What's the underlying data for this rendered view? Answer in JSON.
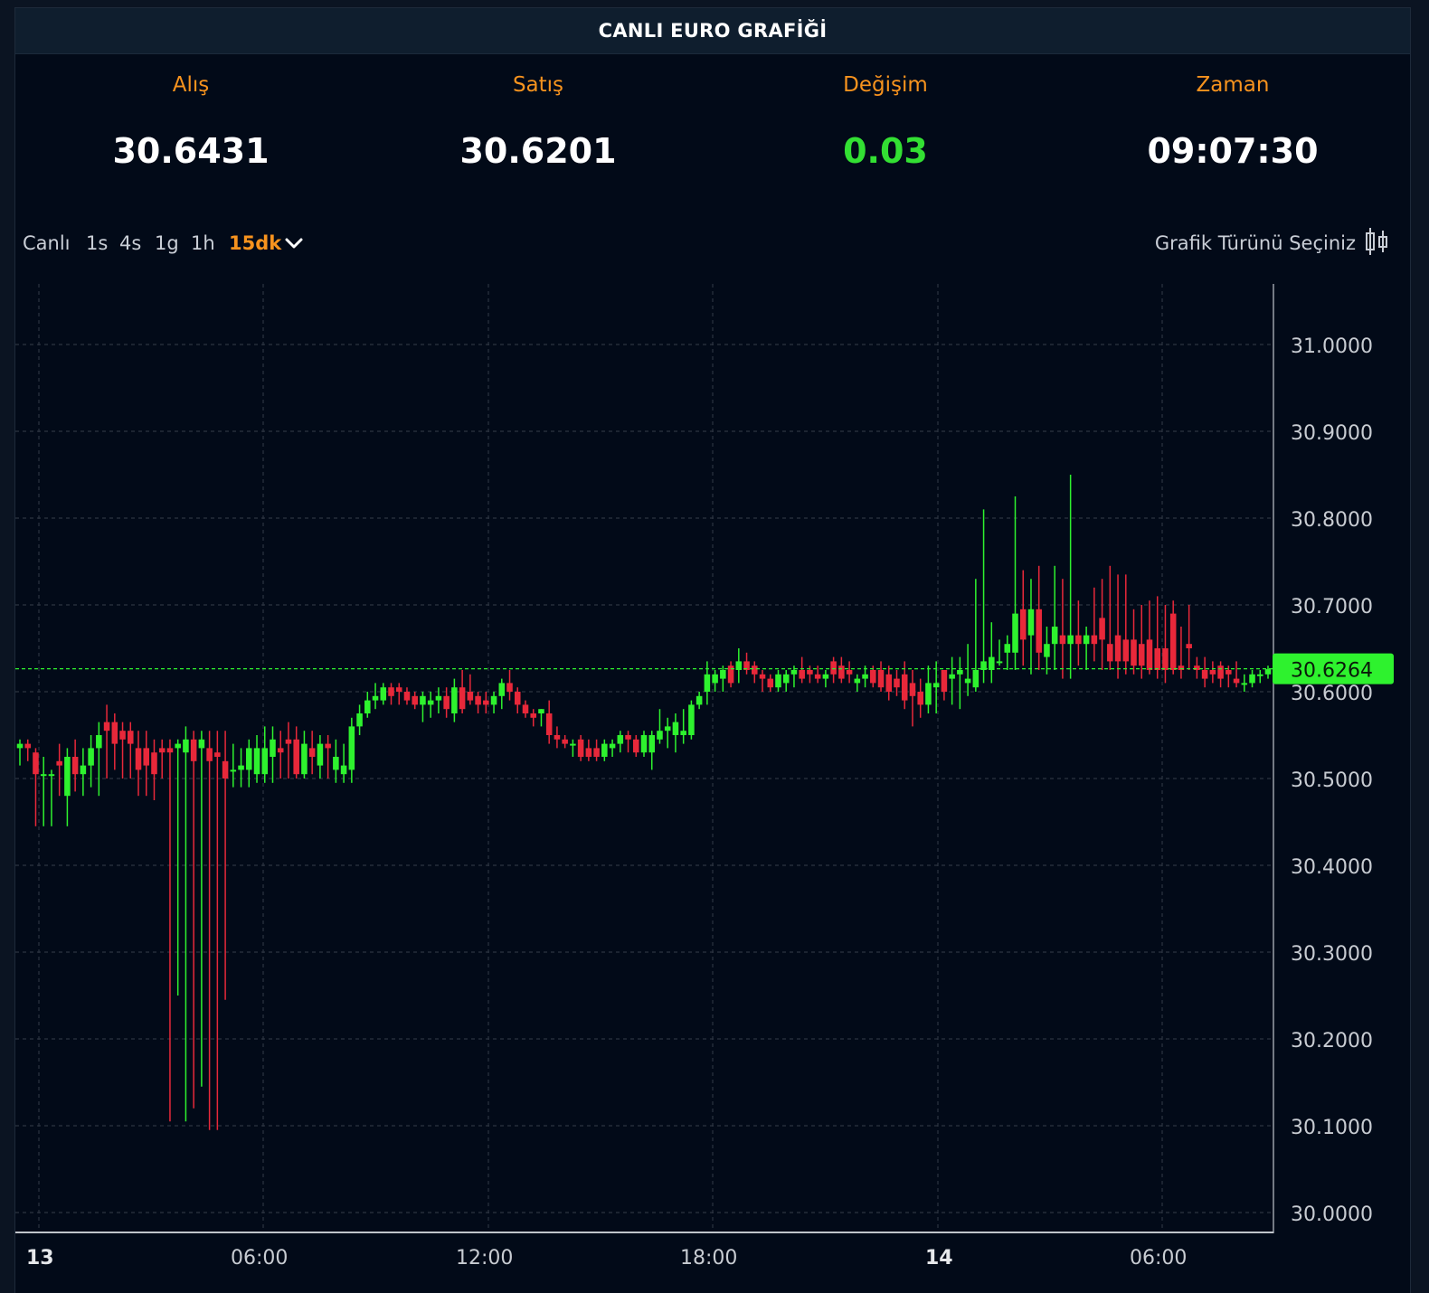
{
  "header": {
    "title": "CANLI EURO GRAFİĞİ"
  },
  "stats": [
    {
      "label": "Alış",
      "value": "30.6431"
    },
    {
      "label": "Satış",
      "value": "30.6201"
    },
    {
      "label": "Değişim",
      "value": "0.03"
    },
    {
      "label": "Zaman",
      "value": "09:07:30"
    }
  ],
  "colors": {
    "accent": "#f7931e",
    "up": "#2ef22e",
    "down": "#e8283a",
    "change_positive": "#33e033",
    "current_price_bg": "#2ef22e"
  },
  "toolbar": {
    "timeframes": [
      "Canlı",
      "1s",
      "4s",
      "1g",
      "1h",
      "15dk"
    ],
    "active_timeframe": "15dk",
    "dropdown_icon": "chevron-down-icon",
    "chart_type_label": "Grafik Türünü Seçiniz",
    "chart_type_icon": "candlestick-icon"
  },
  "chart_data": {
    "type": "candlestick",
    "x_tick_labels": [
      "13",
      "06:00",
      "12:00",
      "18:00",
      "14",
      "06:00"
    ],
    "y_tick_labels": [
      "31.0000",
      "30.9000",
      "30.8000",
      "30.7000",
      "30.6000",
      "30.5000",
      "30.4000",
      "30.3000",
      "30.2000",
      "30.1000",
      "30.0000"
    ],
    "ylim": [
      29.98,
      31.07
    ],
    "current_price": "30.6264",
    "current_price_value": 30.6264,
    "grid": true,
    "interval": "15dk",
    "candles": [
      [
        30.535,
        30.545,
        30.515,
        30.54
      ],
      [
        30.54,
        30.545,
        30.52,
        30.535
      ],
      [
        30.53,
        30.535,
        30.445,
        30.505
      ],
      [
        30.505,
        30.525,
        30.445,
        30.505
      ],
      [
        30.505,
        30.51,
        30.445,
        30.505
      ],
      [
        30.52,
        30.54,
        30.48,
        30.515
      ],
      [
        30.48,
        30.535,
        30.445,
        30.525
      ],
      [
        30.525,
        30.545,
        30.485,
        30.505
      ],
      [
        30.505,
        30.535,
        30.48,
        30.515
      ],
      [
        30.515,
        30.55,
        30.49,
        30.535
      ],
      [
        30.535,
        30.565,
        30.48,
        30.55
      ],
      [
        30.565,
        30.585,
        30.5,
        30.555
      ],
      [
        30.565,
        30.575,
        30.51,
        30.54
      ],
      [
        30.555,
        30.565,
        30.5,
        30.545
      ],
      [
        30.555,
        30.565,
        30.5,
        30.54
      ],
      [
        30.535,
        30.555,
        30.48,
        30.51
      ],
      [
        30.535,
        30.555,
        30.48,
        30.515
      ],
      [
        30.53,
        30.545,
        30.475,
        30.505
      ],
      [
        30.535,
        30.545,
        30.5,
        30.53
      ],
      [
        30.535,
        30.545,
        30.105,
        30.53
      ],
      [
        30.535,
        30.545,
        30.25,
        30.54
      ],
      [
        30.53,
        30.56,
        30.105,
        30.545
      ],
      [
        30.545,
        30.555,
        30.12,
        30.52
      ],
      [
        30.535,
        30.555,
        30.145,
        30.545
      ],
      [
        30.535,
        30.555,
        30.095,
        30.52
      ],
      [
        30.53,
        30.555,
        30.095,
        30.525
      ],
      [
        30.52,
        30.555,
        30.245,
        30.5
      ],
      [
        30.51,
        30.54,
        30.49,
        30.51
      ],
      [
        30.51,
        30.535,
        30.49,
        30.515
      ],
      [
        30.51,
        30.545,
        30.49,
        30.535
      ],
      [
        30.505,
        30.55,
        30.495,
        30.535
      ],
      [
        30.505,
        30.56,
        30.495,
        30.535
      ],
      [
        30.525,
        30.56,
        30.495,
        30.545
      ],
      [
        30.535,
        30.555,
        30.5,
        30.53
      ],
      [
        30.545,
        30.565,
        30.5,
        30.54
      ],
      [
        30.545,
        30.56,
        30.5,
        30.505
      ],
      [
        30.505,
        30.555,
        30.5,
        30.54
      ],
      [
        30.535,
        30.555,
        30.505,
        30.525
      ],
      [
        30.515,
        30.55,
        30.5,
        30.54
      ],
      [
        30.54,
        30.55,
        30.5,
        30.535
      ],
      [
        30.51,
        30.545,
        30.495,
        30.525
      ],
      [
        30.505,
        30.54,
        30.495,
        30.515
      ],
      [
        30.51,
        30.57,
        30.495,
        30.56
      ],
      [
        30.56,
        30.585,
        30.55,
        30.575
      ],
      [
        30.575,
        30.6,
        30.57,
        30.59
      ],
      [
        30.59,
        30.61,
        30.58,
        30.595
      ],
      [
        30.59,
        30.61,
        30.585,
        30.605
      ],
      [
        30.605,
        30.61,
        30.585,
        30.595
      ],
      [
        30.605,
        30.61,
        30.585,
        30.6
      ],
      [
        30.6,
        30.605,
        30.585,
        30.59
      ],
      [
        30.595,
        30.6,
        30.58,
        30.585
      ],
      [
        30.585,
        30.6,
        30.565,
        30.595
      ],
      [
        30.585,
        30.6,
        30.57,
        30.59
      ],
      [
        30.59,
        30.605,
        30.575,
        30.595
      ],
      [
        30.595,
        30.605,
        30.57,
        30.58
      ],
      [
        30.575,
        30.615,
        30.565,
        30.605
      ],
      [
        30.605,
        30.625,
        30.575,
        30.58
      ],
      [
        30.6,
        30.62,
        30.585,
        30.59
      ],
      [
        30.595,
        30.6,
        30.575,
        30.585
      ],
      [
        30.59,
        30.6,
        30.575,
        30.585
      ],
      [
        30.585,
        30.6,
        30.575,
        30.595
      ],
      [
        30.595,
        30.615,
        30.58,
        30.61
      ],
      [
        30.61,
        30.625,
        30.59,
        30.6
      ],
      [
        30.6,
        30.605,
        30.575,
        30.585
      ],
      [
        30.585,
        30.59,
        30.57,
        30.575
      ],
      [
        30.575,
        30.58,
        30.56,
        30.57
      ],
      [
        30.575,
        30.58,
        30.56,
        30.58
      ],
      [
        30.575,
        30.59,
        30.54,
        30.55
      ],
      [
        30.55,
        30.56,
        30.535,
        30.545
      ],
      [
        30.545,
        30.55,
        30.535,
        30.54
      ],
      [
        30.54,
        30.545,
        30.525,
        30.54
      ],
      [
        30.545,
        30.55,
        30.52,
        30.525
      ],
      [
        30.535,
        30.545,
        30.52,
        30.525
      ],
      [
        30.535,
        30.545,
        30.52,
        30.525
      ],
      [
        30.525,
        30.545,
        30.52,
        30.54
      ],
      [
        30.535,
        30.545,
        30.525,
        30.54
      ],
      [
        30.54,
        30.555,
        30.53,
        30.55
      ],
      [
        30.55,
        30.555,
        30.53,
        30.545
      ],
      [
        30.545,
        30.55,
        30.525,
        30.53
      ],
      [
        30.53,
        30.555,
        30.525,
        30.55
      ],
      [
        30.53,
        30.555,
        30.51,
        30.55
      ],
      [
        30.545,
        30.58,
        30.54,
        30.555
      ],
      [
        30.555,
        30.57,
        30.535,
        30.56
      ],
      [
        30.55,
        30.575,
        30.53,
        30.565
      ],
      [
        30.55,
        30.58,
        30.54,
        30.555
      ],
      [
        30.55,
        30.59,
        30.545,
        30.585
      ],
      [
        30.585,
        30.6,
        30.58,
        30.595
      ],
      [
        30.6,
        30.635,
        30.585,
        30.62
      ],
      [
        30.61,
        30.625,
        30.6,
        30.62
      ],
      [
        30.615,
        30.63,
        30.6,
        30.625
      ],
      [
        30.63,
        30.635,
        30.605,
        30.61
      ],
      [
        30.625,
        30.65,
        30.61,
        30.635
      ],
      [
        30.635,
        30.645,
        30.62,
        30.625
      ],
      [
        30.63,
        30.635,
        30.61,
        30.62
      ],
      [
        30.62,
        30.625,
        30.6,
        30.615
      ],
      [
        30.615,
        30.62,
        30.6,
        30.605
      ],
      [
        30.605,
        30.625,
        30.6,
        30.62
      ],
      [
        30.61,
        30.625,
        30.6,
        30.62
      ],
      [
        30.62,
        30.63,
        30.605,
        30.625
      ],
      [
        30.625,
        30.64,
        30.61,
        30.615
      ],
      [
        30.625,
        30.63,
        30.61,
        30.62
      ],
      [
        30.62,
        30.63,
        30.61,
        30.615
      ],
      [
        30.615,
        30.625,
        30.605,
        30.62
      ],
      [
        30.635,
        30.64,
        30.61,
        30.62
      ],
      [
        30.63,
        30.64,
        30.61,
        30.615
      ],
      [
        30.625,
        30.635,
        30.61,
        30.62
      ],
      [
        30.61,
        30.62,
        30.6,
        30.615
      ],
      [
        30.615,
        30.63,
        30.605,
        30.62
      ],
      [
        30.625,
        30.63,
        30.605,
        30.61
      ],
      [
        30.625,
        30.635,
        30.6,
        30.605
      ],
      [
        30.62,
        30.63,
        30.59,
        30.6
      ],
      [
        30.615,
        30.625,
        30.595,
        30.605
      ],
      [
        30.62,
        30.635,
        30.58,
        30.59
      ],
      [
        30.61,
        30.625,
        30.56,
        30.595
      ],
      [
        30.6,
        30.615,
        30.57,
        30.585
      ],
      [
        30.585,
        30.63,
        30.575,
        30.61
      ],
      [
        30.605,
        30.635,
        30.575,
        30.61
      ],
      [
        30.625,
        30.625,
        30.59,
        30.6
      ],
      [
        30.615,
        30.64,
        30.585,
        30.62
      ],
      [
        30.62,
        30.64,
        30.58,
        30.625
      ],
      [
        30.61,
        30.655,
        30.595,
        30.615
      ],
      [
        30.605,
        30.73,
        30.6,
        30.625
      ],
      [
        30.625,
        30.81,
        30.61,
        30.635
      ],
      [
        30.625,
        30.68,
        30.61,
        30.64
      ],
      [
        30.635,
        30.66,
        30.63,
        30.635
      ],
      [
        30.645,
        30.665,
        30.625,
        30.655
      ],
      [
        30.645,
        30.825,
        30.625,
        30.69
      ],
      [
        30.695,
        30.74,
        30.63,
        30.66
      ],
      [
        30.665,
        30.73,
        30.62,
        30.695
      ],
      [
        30.695,
        30.745,
        30.625,
        30.645
      ],
      [
        30.64,
        30.675,
        30.62,
        30.655
      ],
      [
        30.655,
        30.745,
        30.625,
        30.675
      ],
      [
        30.665,
        30.73,
        30.615,
        30.655
      ],
      [
        30.655,
        30.85,
        30.615,
        30.665
      ],
      [
        30.665,
        30.705,
        30.63,
        30.655
      ],
      [
        30.655,
        30.675,
        30.625,
        30.665
      ],
      [
        30.665,
        30.72,
        30.635,
        30.655
      ],
      [
        30.685,
        30.73,
        30.625,
        30.66
      ],
      [
        30.655,
        30.745,
        30.625,
        30.635
      ],
      [
        30.665,
        30.735,
        30.615,
        30.635
      ],
      [
        30.66,
        30.735,
        30.62,
        30.635
      ],
      [
        30.66,
        30.695,
        30.62,
        30.63
      ],
      [
        30.655,
        30.7,
        30.615,
        30.63
      ],
      [
        30.66,
        30.705,
        30.62,
        30.625
      ],
      [
        30.65,
        30.71,
        30.615,
        30.625
      ],
      [
        30.65,
        30.7,
        30.61,
        30.625
      ],
      [
        30.69,
        30.705,
        30.62,
        30.625
      ],
      [
        30.63,
        30.675,
        30.615,
        30.625
      ],
      [
        30.655,
        30.7,
        30.625,
        30.65
      ],
      [
        30.63,
        30.64,
        30.615,
        30.625
      ],
      [
        30.625,
        30.64,
        30.605,
        30.615
      ],
      [
        30.625,
        30.635,
        30.61,
        30.62
      ],
      [
        30.63,
        30.635,
        30.605,
        30.615
      ],
      [
        30.625,
        30.63,
        30.605,
        30.62
      ],
      [
        30.615,
        30.635,
        30.605,
        30.61
      ],
      [
        30.61,
        30.62,
        30.6,
        30.61
      ],
      [
        30.61,
        30.625,
        30.605,
        30.62
      ],
      [
        30.62,
        30.625,
        30.61,
        30.62
      ],
      [
        30.62,
        30.63,
        30.615,
        30.626
      ]
    ]
  }
}
